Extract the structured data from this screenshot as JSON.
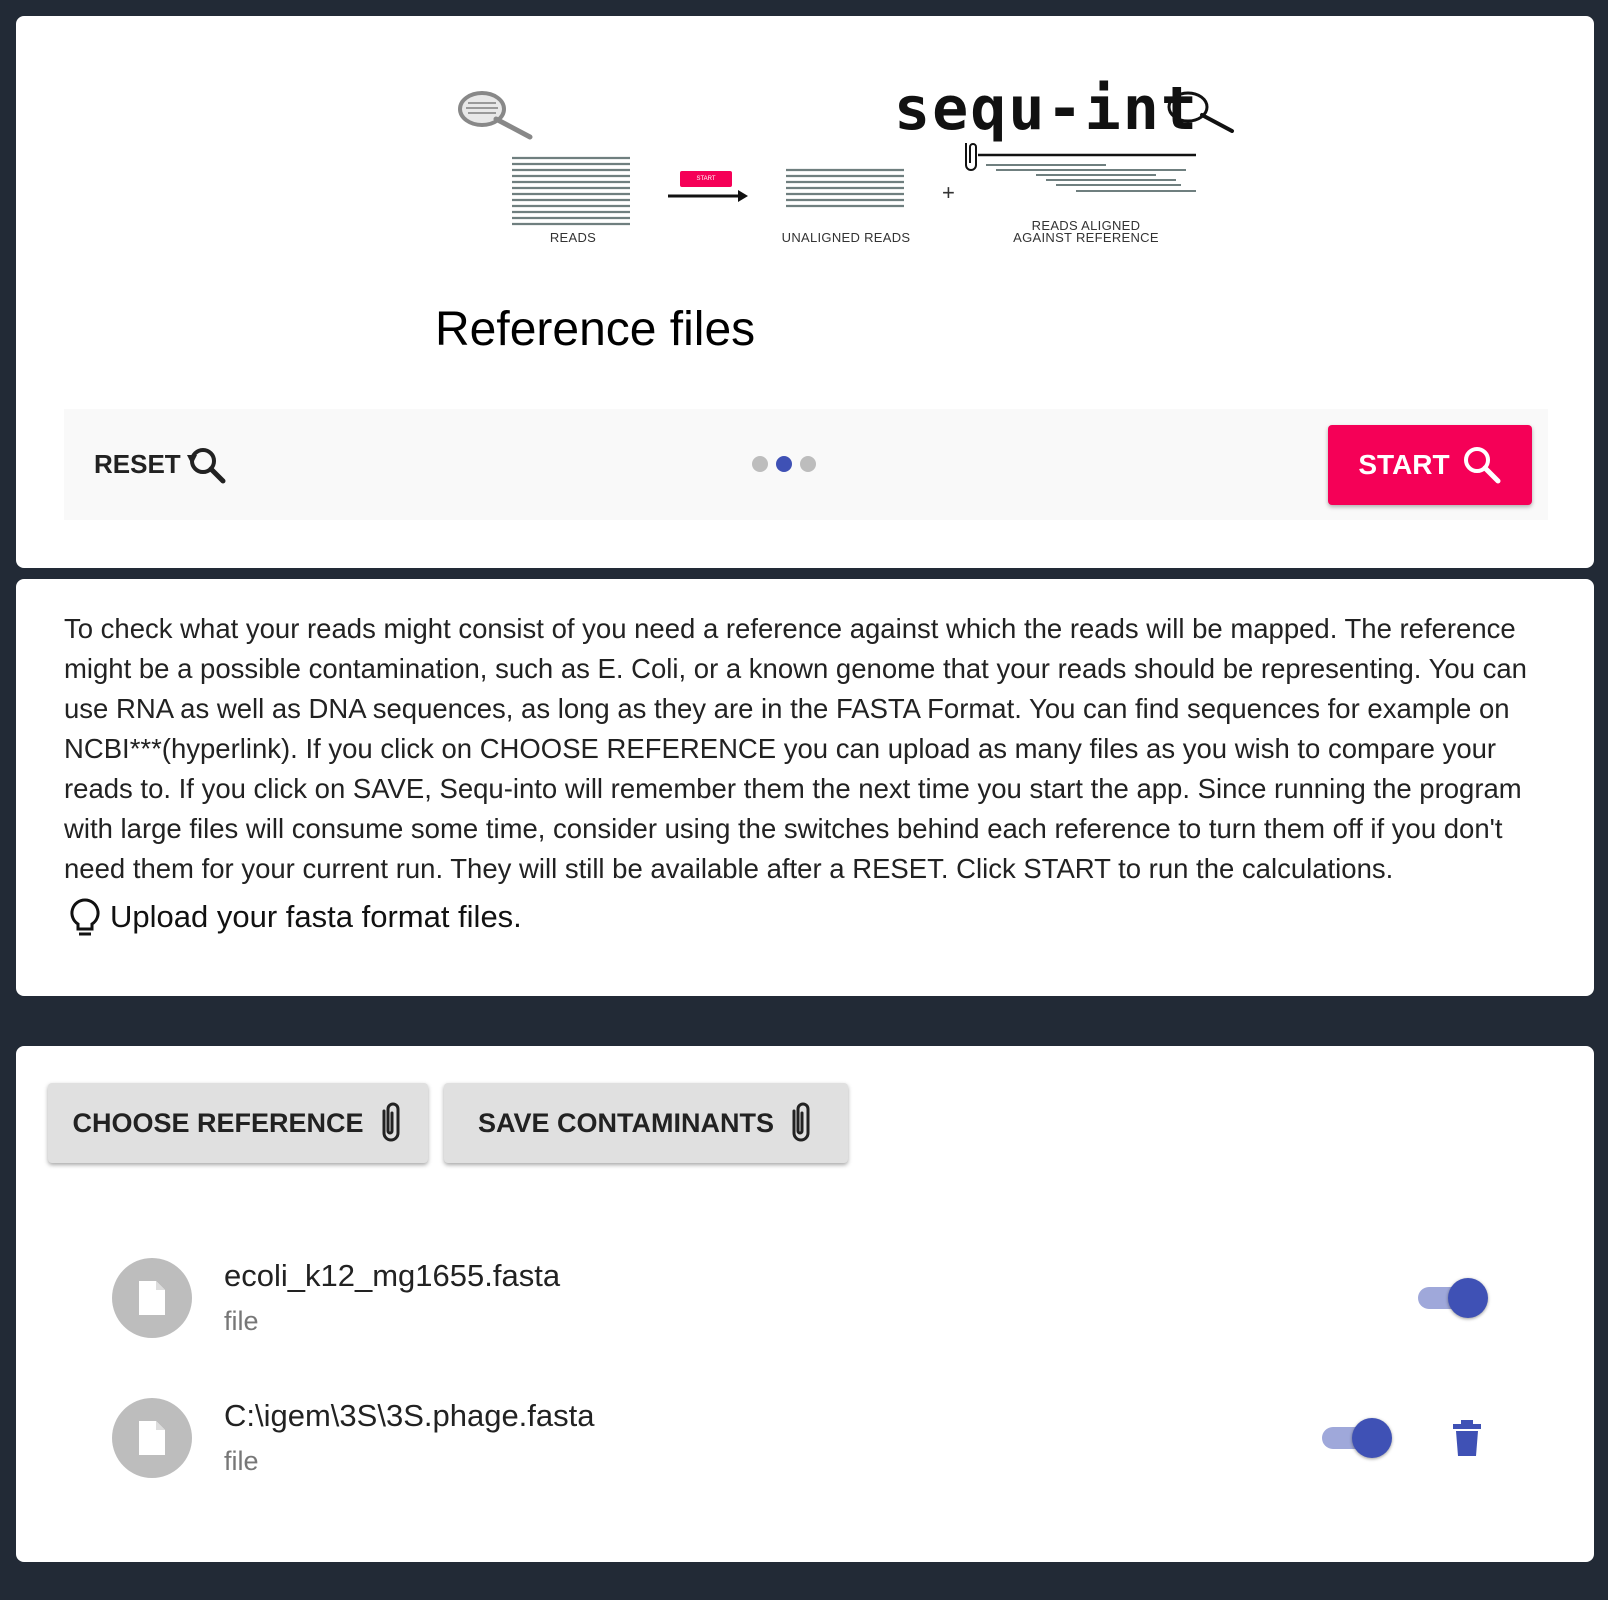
{
  "logo": {
    "wordmark": "sequ-int",
    "mini_start": "START",
    "label_reads": "READS",
    "label_unaligned": "UNALIGNED READS",
    "label_aligned_1": "READS ALIGNED",
    "label_aligned_2": "AGAINST REFERENCE",
    "plus": "+"
  },
  "header": {
    "title": "Reference files"
  },
  "stepper": {
    "reset_label": "RESET",
    "start_label": "START",
    "steps": 3,
    "active_step": 2
  },
  "info": {
    "description": "To check what your reads might consist of you need a reference against which the reads will be mapped. The reference might be a possible contamination, such as E. Coli, or a known genome that your reads should be representing. You can use RNA as well as DNA sequences, as long as they are in the FASTA Format. You can find sequences for example on NCBI***(hyperlink). If you click on CHOOSE REFERENCE you can upload as many files as you wish to compare your reads to. If you click on SAVE, Sequ-into will remember them the next time you start the app. Since running the program with large files will consume some time, consider using the switches behind each reference to turn them off if you don't need them for your current run. They will still be available after a RESET. Click START to run the calculations.",
    "hint": "Upload your fasta format files."
  },
  "actions": {
    "choose_label": "CHOOSE REFERENCE",
    "save_label": "SAVE CONTAMINANTS"
  },
  "files": [
    {
      "name": "ecoli_k12_mg1655.fasta",
      "type": "file",
      "enabled": true,
      "deletable": false
    },
    {
      "name": "C:\\igem\\3S\\3S.phage.fasta",
      "type": "file",
      "enabled": true,
      "deletable": true
    }
  ],
  "colors": {
    "background": "#222a36",
    "accent_pink": "#f50057",
    "primary": "#3f51b5",
    "toggle_track": "#9fa8da"
  }
}
